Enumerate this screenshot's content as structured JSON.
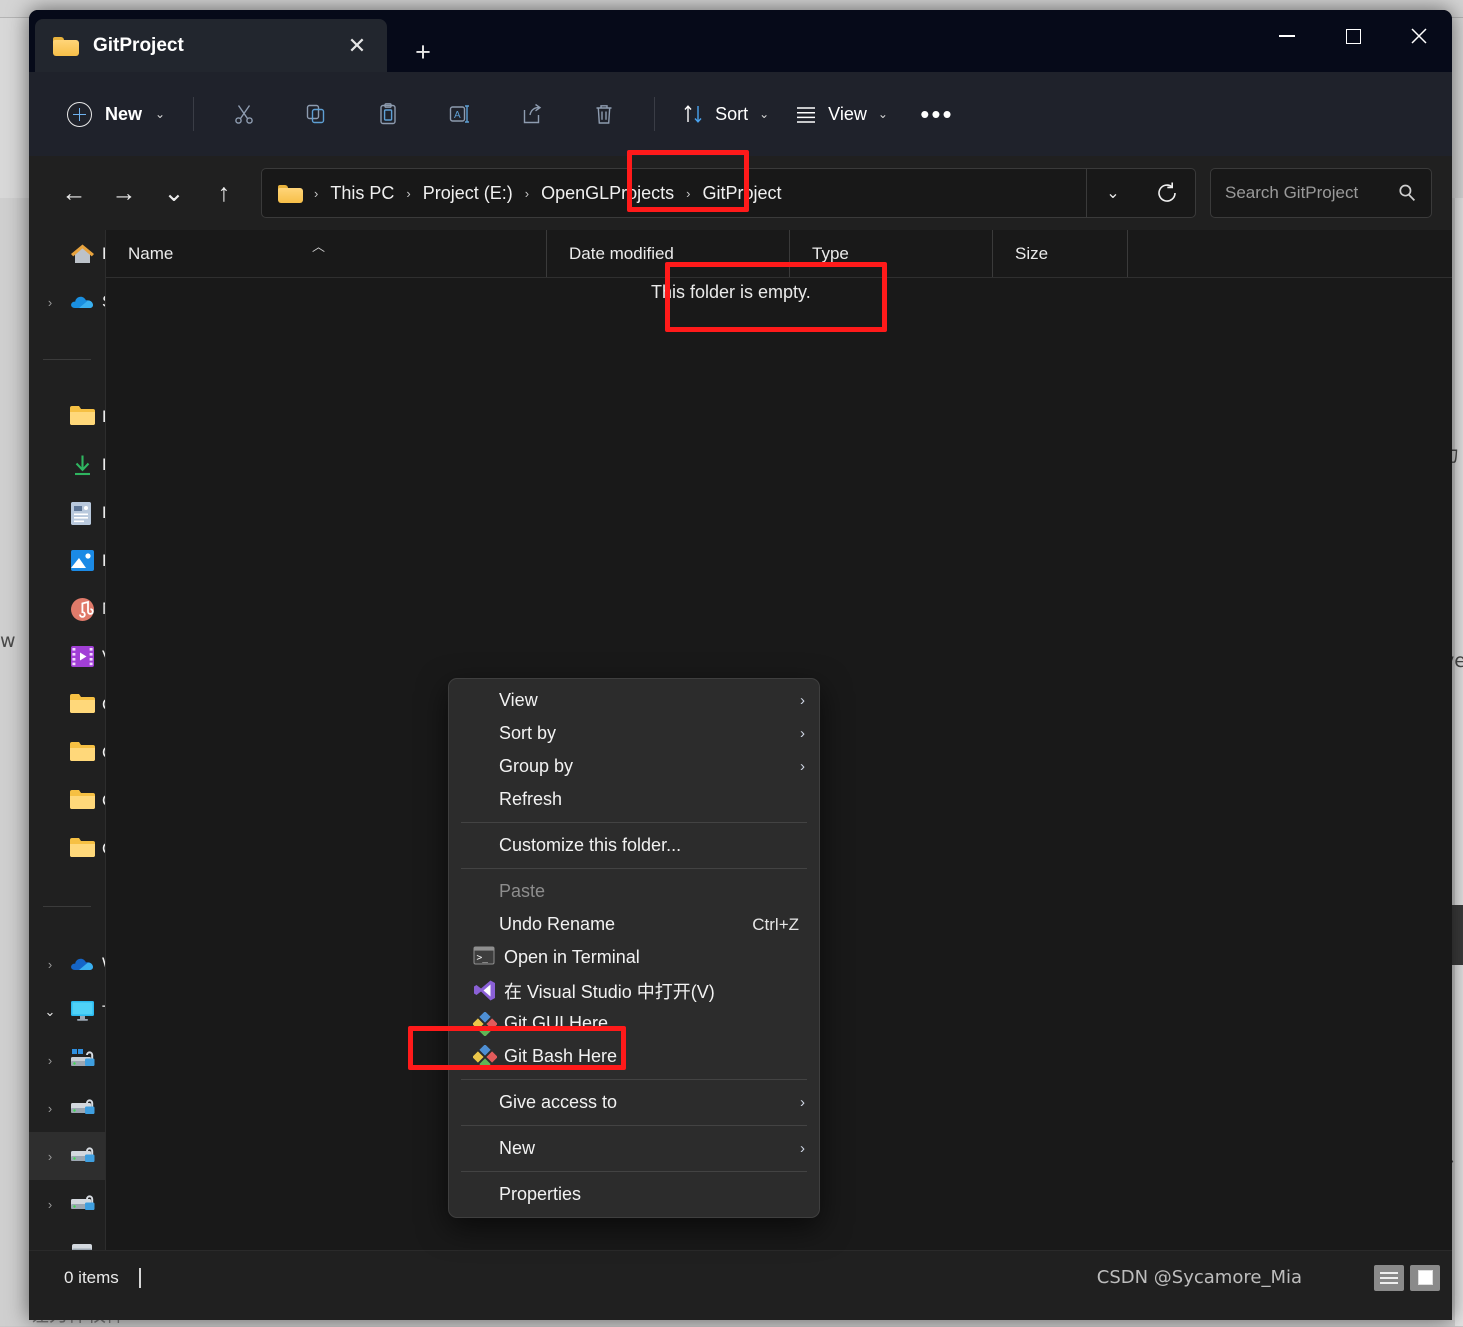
{
  "window": {
    "tab_title": "GitProject",
    "tab_close_glyph": "✕",
    "new_tab_glyph": "+",
    "minimize_label": "Minimize",
    "maximize_label": "Maximize",
    "close_label": "Close"
  },
  "toolbar": {
    "new_label": "New",
    "new_chevron": "⌄",
    "sort_label": "Sort",
    "sort_chevron": "⌄",
    "view_label": "View",
    "view_chevron": "⌄",
    "overflow_glyph": "•••",
    "icons": [
      "cut-icon",
      "copy-icon",
      "paste-icon",
      "rename-icon",
      "share-icon",
      "delete-icon"
    ]
  },
  "address": {
    "back_glyph": "←",
    "forward_glyph": "→",
    "recent_glyph": "⌄",
    "up_glyph": "↑",
    "breadcrumbs": [
      "This PC",
      "Project (E:)",
      "OpenGLProjects",
      "GitProject"
    ],
    "separator": "›",
    "dropdown_glyph": "⌄",
    "refresh_label": "Refresh",
    "highlighted_crumb": "GitProject"
  },
  "search": {
    "placeholder": "Search GitProject"
  },
  "columns": [
    {
      "label": "Name",
      "sorted": true,
      "sort_glyph": "︿"
    },
    {
      "label": "Date modified"
    },
    {
      "label": "Type"
    },
    {
      "label": "Size"
    }
  ],
  "content": {
    "empty_message": "This folder is empty."
  },
  "nav": {
    "items": [
      {
        "label": "Home",
        "icon": "home-icon",
        "expander": ""
      },
      {
        "label": "S",
        "icon": "onedrive-icon",
        "expander": "›"
      },
      {
        "label": "Desktop",
        "icon": "folder-icon",
        "expander": ""
      },
      {
        "label": "Downloads",
        "icon": "downloads-icon",
        "expander": ""
      },
      {
        "label": "Documents",
        "icon": "documents-icon",
        "expander": ""
      },
      {
        "label": "Pictures",
        "icon": "pictures-icon",
        "expander": ""
      },
      {
        "label": "Music",
        "icon": "music-icon",
        "expander": ""
      },
      {
        "label": "Videos",
        "icon": "videos-icon",
        "expander": ""
      },
      {
        "label": "O",
        "icon": "folder-icon",
        "expander": ""
      },
      {
        "label": "O",
        "icon": "folder-icon",
        "expander": ""
      },
      {
        "label": "O",
        "icon": "folder-icon",
        "expander": ""
      },
      {
        "label": "O",
        "icon": "folder-icon",
        "expander": ""
      },
      {
        "label": "W",
        "icon": "onedrive-icon",
        "expander": "›"
      },
      {
        "label": "T",
        "icon": "thispc-icon",
        "expander": "⌄"
      },
      {
        "label": "",
        "icon": "windows-drive-icon",
        "expander": "›"
      },
      {
        "label": "",
        "icon": "drive-icon",
        "expander": "›"
      },
      {
        "label": "",
        "icon": "drive-icon",
        "expander": "›",
        "selected": true
      },
      {
        "label": "",
        "icon": "drive-icon",
        "expander": "›"
      },
      {
        "label": "",
        "icon": "dvd-drive-icon",
        "expander": "›"
      },
      {
        "label": "",
        "icon": "network-icon",
        "expander": "›"
      }
    ]
  },
  "context_menu": {
    "items": [
      {
        "label": "View",
        "submenu": true,
        "icon": null
      },
      {
        "label": "Sort by",
        "submenu": true,
        "icon": null
      },
      {
        "label": "Group by",
        "submenu": true,
        "icon": null
      },
      {
        "label": "Refresh",
        "submenu": false,
        "icon": null
      },
      {
        "separator": true
      },
      {
        "label": "Customize this folder...",
        "submenu": false,
        "icon": null
      },
      {
        "separator": true
      },
      {
        "label": "Paste",
        "submenu": false,
        "icon": null,
        "disabled": true
      },
      {
        "label": "Undo Rename",
        "submenu": false,
        "icon": null,
        "accel": "Ctrl+Z"
      },
      {
        "label": "Open in Terminal",
        "submenu": false,
        "icon": "terminal-icon"
      },
      {
        "label": "在 Visual Studio 中打开(V)",
        "submenu": false,
        "icon": "visual-studio-icon"
      },
      {
        "label": "Git GUI Here",
        "submenu": false,
        "icon": "git-icon"
      },
      {
        "label": "Git Bash Here",
        "submenu": false,
        "icon": "git-icon",
        "highlighted": true
      },
      {
        "separator": true
      },
      {
        "label": "Give access to",
        "submenu": true,
        "icon": null
      },
      {
        "separator": true
      },
      {
        "label": "New",
        "submenu": true,
        "icon": null
      },
      {
        "separator": true
      },
      {
        "label": "Properties",
        "submenu": false,
        "icon": null
      }
    ],
    "submenu_glyph": "›"
  },
  "status": {
    "item_count": "0 items",
    "watermark": "CSDN @Sycamore_Mia",
    "view_details_label": "Details view",
    "view_tiles_label": "Large icons view"
  },
  "annotations": {
    "accent_color": "#ff1a1a",
    "boxes": [
      "breadcrumb-gitproject",
      "empty-folder-message",
      "git-bash-here-item"
    ]
  }
}
